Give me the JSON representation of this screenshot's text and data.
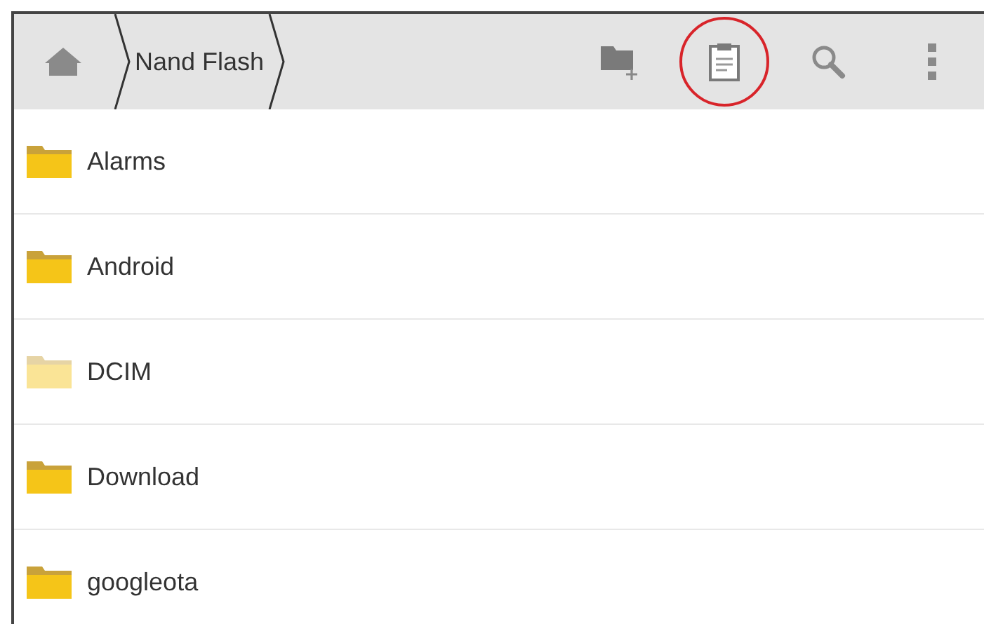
{
  "toolbar": {
    "breadcrumb": "Nand Flash",
    "actions": [
      {
        "kind": "new-folder",
        "circled": false
      },
      {
        "kind": "clipboard",
        "circled": true
      },
      {
        "kind": "search",
        "circled": false
      },
      {
        "kind": "overflow",
        "circled": false
      }
    ]
  },
  "folders": [
    {
      "name": "Alarms",
      "dimmed": false
    },
    {
      "name": "Android",
      "dimmed": false
    },
    {
      "name": "DCIM",
      "dimmed": true
    },
    {
      "name": "Download",
      "dimmed": false
    },
    {
      "name": "googleota",
      "dimmed": false
    }
  ]
}
